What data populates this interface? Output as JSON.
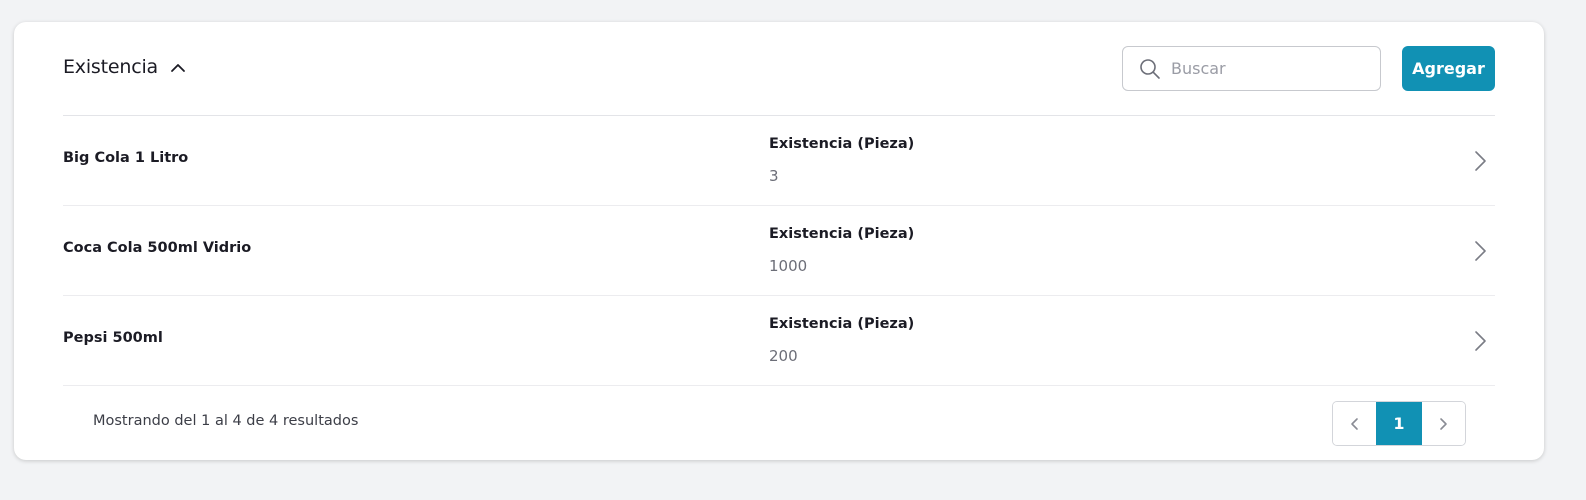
{
  "header": {
    "title": "Existencia",
    "search_placeholder": "Buscar",
    "search_value": "",
    "add_label": "Agregar"
  },
  "rows": [
    {
      "name": "Big Cola 1 Litro",
      "label": "Existencia (Pieza)",
      "value": "3"
    },
    {
      "name": "Coca Cola 500ml Vidrio",
      "label": "Existencia (Pieza)",
      "value": "1000"
    },
    {
      "name": "Pepsi 500ml",
      "label": "Existencia (Pieza)",
      "value": "200"
    }
  ],
  "footer": {
    "summary": "Mostrando del 1 al 4 de 4 resultados",
    "current_page": "1"
  },
  "icons": {
    "title_toggle": "chevron-up-icon",
    "search": "search-icon",
    "row_open": "chevron-right-icon",
    "prev_page": "chevron-left-icon",
    "next_page": "chevron-right-icon"
  },
  "colors": {
    "accent": "#1191b4",
    "background": "#f2f3f5",
    "card": "#ffffff"
  }
}
